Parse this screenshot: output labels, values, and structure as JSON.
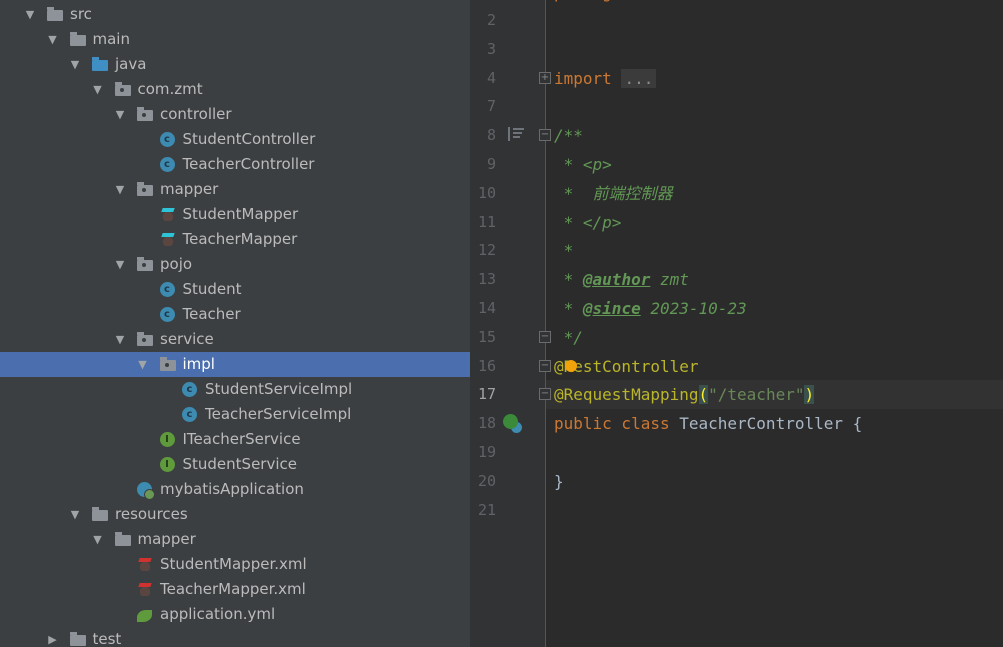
{
  "project_tree": {
    "items": [
      {
        "label": "src",
        "level": 0,
        "state": "open",
        "icon": "folder-icon"
      },
      {
        "label": "main",
        "level": 1,
        "state": "open",
        "icon": "folder-icon"
      },
      {
        "label": "java",
        "level": 2,
        "state": "open",
        "icon": "source-folder-icon"
      },
      {
        "label": "com.zmt",
        "level": 3,
        "state": "open",
        "icon": "package-icon"
      },
      {
        "label": "controller",
        "level": 4,
        "state": "open",
        "icon": "package-icon"
      },
      {
        "label": "StudentController",
        "level": 5,
        "icon": "class-icon"
      },
      {
        "label": "TeacherController",
        "level": 5,
        "icon": "class-icon"
      },
      {
        "label": "mapper",
        "level": 4,
        "state": "open",
        "icon": "package-icon"
      },
      {
        "label": "StudentMapper",
        "level": 5,
        "icon": "mybatis-mapper-icon"
      },
      {
        "label": "TeacherMapper",
        "level": 5,
        "icon": "mybatis-mapper-icon"
      },
      {
        "label": "pojo",
        "level": 4,
        "state": "open",
        "icon": "package-icon"
      },
      {
        "label": "Student",
        "level": 5,
        "icon": "class-icon"
      },
      {
        "label": "Teacher",
        "level": 5,
        "icon": "class-icon"
      },
      {
        "label": "service",
        "level": 4,
        "state": "open",
        "icon": "package-icon"
      },
      {
        "label": "impl",
        "level": 5,
        "state": "open",
        "icon": "package-icon",
        "selected": true
      },
      {
        "label": "StudentServiceImpl",
        "level": 6,
        "icon": "class-icon"
      },
      {
        "label": "TeacherServiceImpl",
        "level": 6,
        "icon": "class-icon"
      },
      {
        "label": "ITeacherService",
        "level": 5,
        "icon": "interface-icon"
      },
      {
        "label": "StudentService",
        "level": 5,
        "icon": "interface-icon"
      },
      {
        "label": "mybatisApplication",
        "level": 4,
        "icon": "spring-boot-class-icon"
      },
      {
        "label": "resources",
        "level": 2,
        "state": "open",
        "icon": "resources-folder-icon"
      },
      {
        "label": "mapper",
        "level": 3,
        "state": "open",
        "icon": "folder-icon"
      },
      {
        "label": "StudentMapper.xml",
        "level": 4,
        "icon": "mybatis-xml-icon"
      },
      {
        "label": "TeacherMapper.xml",
        "level": 4,
        "icon": "mybatis-xml-icon"
      },
      {
        "label": "application.yml",
        "level": 4,
        "icon": "yaml-config-icon"
      },
      {
        "label": "test",
        "level": 1,
        "state": "closed",
        "icon": "folder-icon"
      }
    ]
  },
  "editor": {
    "current_line": "17",
    "lines": [
      {
        "n": "2",
        "tokens": []
      },
      {
        "n": "3",
        "tokens": []
      },
      {
        "n": "4",
        "fold": "+",
        "tokens": [
          {
            "c": "kw",
            "t": "import"
          },
          {
            "c": "",
            "t": " "
          },
          {
            "c": "dots",
            "t": "..."
          }
        ]
      },
      {
        "n": "7",
        "tokens": []
      },
      {
        "n": "8",
        "fold": "-",
        "tokens": [
          {
            "c": "doc",
            "t": "/**"
          }
        ]
      },
      {
        "n": "9",
        "tokens": [
          {
            "c": "doc",
            "t": " * <p>"
          }
        ]
      },
      {
        "n": "10",
        "tokens": [
          {
            "c": "doc",
            "t": " *  前端控制器"
          }
        ]
      },
      {
        "n": "11",
        "tokens": [
          {
            "c": "doc",
            "t": " * </p>"
          }
        ]
      },
      {
        "n": "12",
        "tokens": [
          {
            "c": "doc",
            "t": " *"
          }
        ]
      },
      {
        "n": "13",
        "tokens": [
          {
            "c": "doc",
            "t": " * "
          },
          {
            "c": "tag",
            "t": "@author"
          },
          {
            "c": "doc",
            "t": " zmt"
          }
        ]
      },
      {
        "n": "14",
        "tokens": [
          {
            "c": "doc",
            "t": " * "
          },
          {
            "c": "tag",
            "t": "@since"
          },
          {
            "c": "doc",
            "t": " 2023-10-23"
          }
        ]
      },
      {
        "n": "15",
        "fold": "-",
        "tokens": [
          {
            "c": "doc",
            "t": " */"
          }
        ]
      },
      {
        "n": "16",
        "fold": "-",
        "tokens": [
          {
            "c": "ann",
            "t": "@RestController"
          }
        ]
      },
      {
        "n": "17",
        "fold": "-",
        "tokens": [
          {
            "c": "ann",
            "t": "@RequestMapping"
          },
          {
            "c": "brm",
            "t": "("
          },
          {
            "c": "str",
            "t": "\"/teacher\""
          },
          {
            "c": "brm",
            "t": ")"
          }
        ]
      },
      {
        "n": "18",
        "tokens": [
          {
            "c": "kw",
            "t": "public class "
          },
          {
            "c": "",
            "t": "TeacherController {"
          }
        ]
      },
      {
        "n": "19",
        "tokens": []
      },
      {
        "n": "20",
        "tokens": [
          {
            "c": "",
            "t": "}"
          }
        ]
      },
      {
        "n": "21",
        "tokens": []
      }
    ]
  },
  "colors": {
    "tree_bg": "#3c3f41",
    "selection": "#4b6eaf",
    "editor_bg": "#2b2b2b",
    "keyword": "#cc7832",
    "comment": "#629755",
    "annotation": "#bbb529",
    "string": "#6a8759"
  }
}
